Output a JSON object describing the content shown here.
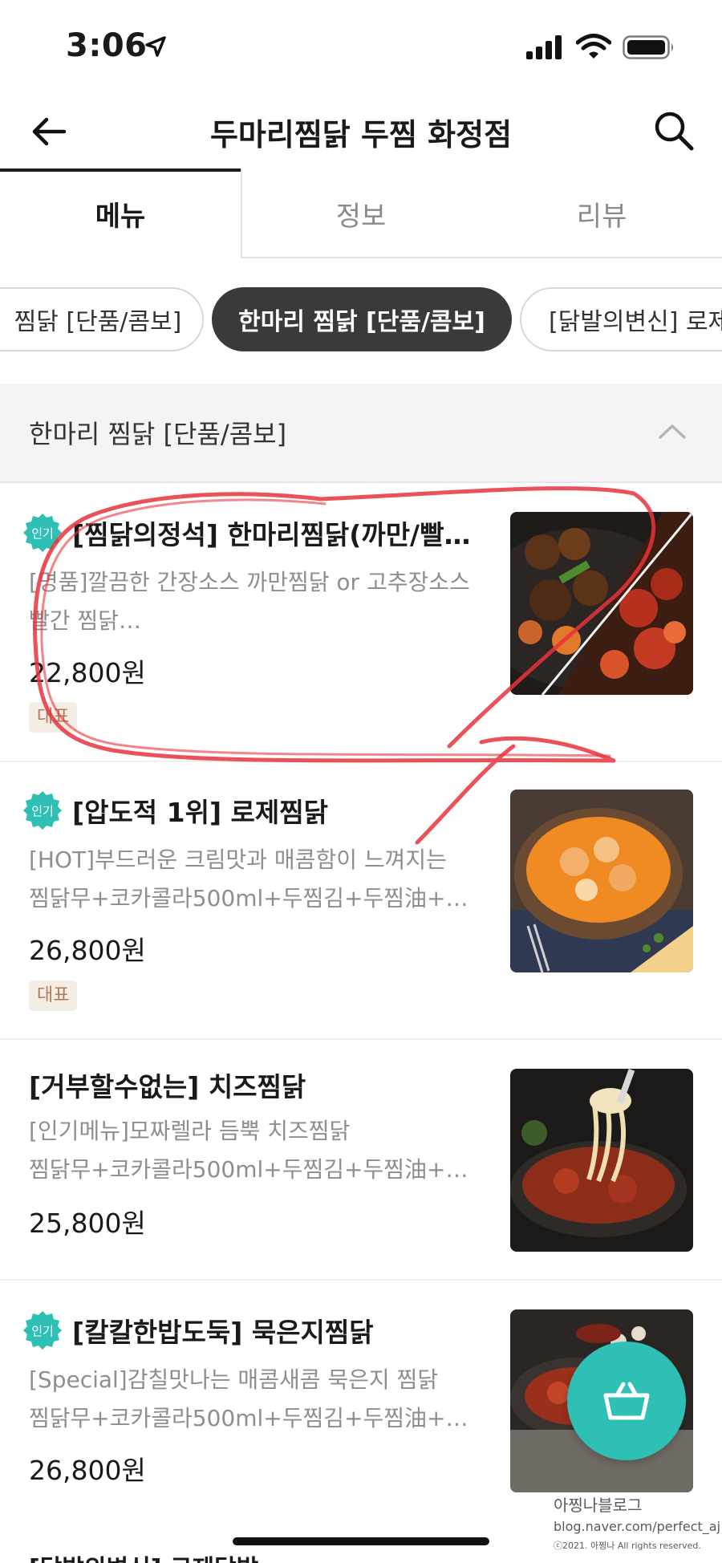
{
  "status_bar": {
    "time": "3:06"
  },
  "header": {
    "title": "두마리찜닭 두찜 화정점"
  },
  "tabs": [
    {
      "label": "메뉴",
      "active": true
    },
    {
      "label": "정보",
      "active": false
    },
    {
      "label": "리뷰",
      "active": false
    }
  ],
  "category_chips": [
    {
      "label": "찜닭 [단품/콤보]",
      "active": false
    },
    {
      "label": "한마리 찜닭 [단품/콤보]",
      "active": true
    },
    {
      "label": "[닭발의변신] 로제닭",
      "active": false
    }
  ],
  "section": {
    "title": "한마리 찜닭 [단품/콤보]"
  },
  "badge_popular": "인기",
  "badge_rep": "대표",
  "menu_items": [
    {
      "name": "[찜닭의정석] 한마리찜닭(까만/빨…",
      "desc1": "[명품]깔끔한 간장소스 까만찜닭 or 고추장소스",
      "desc2": "빨간 찜닭…",
      "price": "22,800원"
    },
    {
      "name": "[압도적 1위] 로제찜닭",
      "desc1": "[HOT]부드러운 크림맛과 매콤함이 느껴지는",
      "desc2": "찜닭무+코카콜라500ml+두찜김+두찜油+한…",
      "price": "26,800원"
    },
    {
      "name": "[거부할수없는] 치즈찜닭",
      "desc1": "[인기메뉴]모짜렐라 듬뿍 치즈찜닭",
      "desc2": "찜닭무+코카콜라500ml+두찜김+두찜油+한…",
      "price": "25,800원"
    },
    {
      "name": "[칼칼한밥도둑] 묵은지찜닭",
      "desc1": "[Special]감칠맛나는 매콤새콤 묵은지 찜닭",
      "desc2": "찜닭무+코카콜라500ml+두찜김+두찜油+한…",
      "price": "26,800원"
    }
  ],
  "next_item_peek": "[닭발의변신] 로제닭발",
  "watermark": {
    "name": "아찡나블로그",
    "url": "blog.naver.com/perfect_aj",
    "copyright": "ⓒ2021. 아찡나 All rights reserved."
  },
  "colors": {
    "accent": "#2ec0b4",
    "chip_active": "#3a3a3a",
    "annotation": "#e8333b"
  }
}
